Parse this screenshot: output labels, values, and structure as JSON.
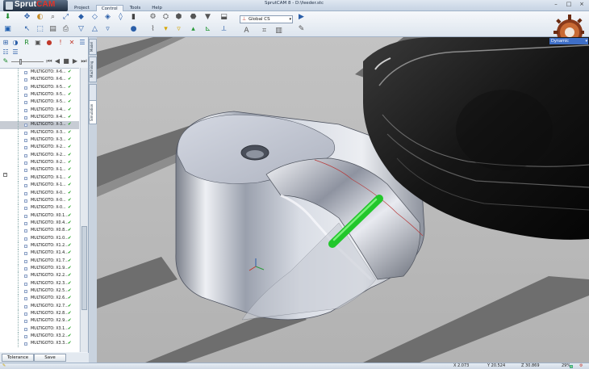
{
  "app": {
    "logo_text": "Sprut",
    "logo_text_accent": "CAM",
    "window_title": "SprutCAM 8 - D:\\feeder.stc",
    "menus": [
      "Project",
      "Control",
      "Tools",
      "Help"
    ],
    "active_menu": "Control"
  },
  "ribbon": {
    "cs_dropdown_value": "Global CS"
  },
  "left_panel": {
    "side_tabs": [
      "Model",
      "Machining",
      "Simulation"
    ],
    "active_side_tab": "Simulation",
    "operations": [
      {
        "label": "MULTIGOTO: X-6..."
      },
      {
        "label": "MULTIGOTO: X-6..."
      },
      {
        "label": "MULTIGOTO: X-5..."
      },
      {
        "label": "MULTIGOTO: X-5..."
      },
      {
        "label": "MULTIGOTO: X-5..."
      },
      {
        "label": "MULTIGOTO: X-4..."
      },
      {
        "label": "MULTIGOTO: X-4..."
      },
      {
        "label": "MULTIGOTO: X-3..."
      },
      {
        "label": "MULTIGOTO: X-3..."
      },
      {
        "label": "MULTIGOTO: X-3..."
      },
      {
        "label": "MULTIGOTO: X-2..."
      },
      {
        "label": "MULTIGOTO: X-2..."
      },
      {
        "label": "MULTIGOTO: X-2..."
      },
      {
        "label": "MULTIGOTO: X-1..."
      },
      {
        "label": "MULTIGOTO: X-1..."
      },
      {
        "label": "MULTIGOTO: X-1..."
      },
      {
        "label": "MULTIGOTO: X-0..."
      },
      {
        "label": "MULTIGOTO: X-0..."
      },
      {
        "label": "MULTIGOTO: X-0..."
      },
      {
        "label": "MULTIGOTO: X0.1..."
      },
      {
        "label": "MULTIGOTO: X0.4..."
      },
      {
        "label": "MULTIGOTO: X0.8..."
      },
      {
        "label": "MULTIGOTO: X1.0..."
      },
      {
        "label": "MULTIGOTO: X1.2..."
      },
      {
        "label": "MULTIGOTO: X1.4..."
      },
      {
        "label": "MULTIGOTO: X1.7..."
      },
      {
        "label": "MULTIGOTO: X1.9..."
      },
      {
        "label": "MULTIGOTO: X2.2..."
      },
      {
        "label": "MULTIGOTO: X2.3..."
      },
      {
        "label": "MULTIGOTO: X2.5..."
      },
      {
        "label": "MULTIGOTO: X2.6..."
      },
      {
        "label": "MULTIGOTO: X2.7..."
      },
      {
        "label": "MULTIGOTO: X2.8..."
      },
      {
        "label": "MULTIGOTO: X2.9..."
      },
      {
        "label": "MULTIGOTO: X3.1..."
      },
      {
        "label": "MULTIGOTO: X3.2..."
      },
      {
        "label": "MULTIGOTO: X3.3..."
      }
    ],
    "selected_index": 7,
    "tolerance_label": "Tolerance",
    "save_label": "Save"
  },
  "viewport": {
    "view_dropdown": "Dynamic",
    "colors": {
      "background": "#b7b7b7",
      "tool": "#26d42b",
      "spindle": "#1a1a1a",
      "part": "#c8cdd8"
    }
  },
  "status": {
    "x": "X 2.073",
    "y": "Y 20.524",
    "z": "Z 30.869",
    "zoom": "29%",
    "progress_fraction": 0.29
  }
}
